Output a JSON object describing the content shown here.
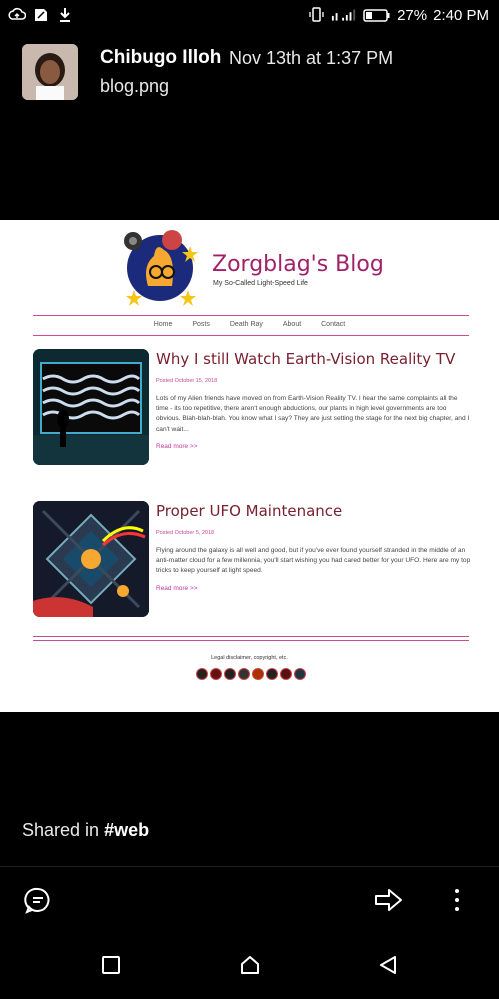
{
  "status_bar": {
    "battery": "27%",
    "time": "2:40 PM"
  },
  "message": {
    "author": "Chibugo Illoh",
    "timestamp": "Nov 13th at 1:37 PM",
    "filename": "blog.png"
  },
  "blog": {
    "title": "Zorgblag's Blog",
    "subtitle": "My So-Called Light-Speed Life",
    "nav": [
      "Home",
      "Posts",
      "Death Ray",
      "About",
      "Contact"
    ],
    "posts": [
      {
        "title": "Why I still Watch Earth-Vision Reality TV",
        "date": "Posted October 15, 2018",
        "body": "Lots of my Alien friends have moved on from Earth-Vision Reality TV. I hear the same complaints all the time - its too repetitive, there aren't enough abductions, our plants in high level governments are too obvious. Blah-blah-blah. You know what I say? They are just setting the stage for the next big chapter, and I can't wait...",
        "read_more": "Read more >>"
      },
      {
        "title": "Proper UFO Maintenance",
        "date": "Posted October 5, 2018",
        "body": "Flying around the galaxy is all well and good, but if you've ever found yourself stranded in the middle of an anti-matter cloud for a few millennia, you'll start wishing you had cared better for your UFO. Here are my top tricks to keep yourself at light speed.",
        "read_more": "Read more >>"
      }
    ],
    "legal": "Legal disclaimer, copyright, etc."
  },
  "shared": {
    "prefix": "Shared in ",
    "channel": "#web"
  },
  "colors": {
    "accent": "#a1206a",
    "link": "#c0399a",
    "post_title": "#7a2030"
  }
}
